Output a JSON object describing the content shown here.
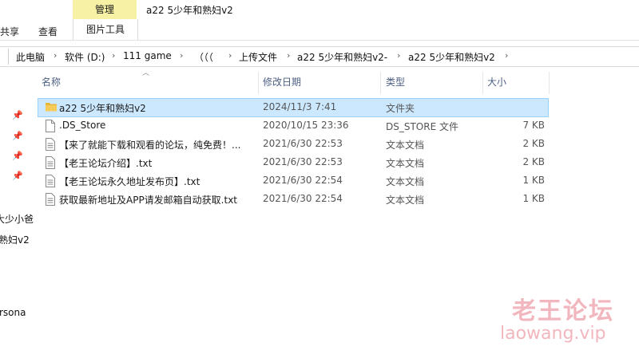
{
  "ribbon": {
    "tab_share": "共享",
    "tab_view": "查看",
    "context_group": "管理",
    "context_tab": "图片工具",
    "window_title": "a22 5少年和熟妇v2"
  },
  "breadcrumb": [
    "此电脑",
    "软件 (D:)",
    "111 game",
    "（（（",
    "上传文件",
    "a22 5少年和熟妇v2-",
    "a22 5少年和熟妇v2"
  ],
  "nav": {
    "partial_items": [
      "大少小爸",
      "熟妇v2",
      "rsona"
    ]
  },
  "columns": {
    "name": "名称",
    "date": "修改日期",
    "type": "类型",
    "size": "大小"
  },
  "files": [
    {
      "name": "a22 5少年和熟妇v2",
      "date": "2024/11/3 7:41",
      "type": "文件夹",
      "size": "",
      "icon": "folder-icon",
      "selected": true
    },
    {
      "name": ".DS_Store",
      "date": "2020/10/15 23:36",
      "type": "DS_STORE 文件",
      "size": "7 KB",
      "icon": "file-icon",
      "selected": false
    },
    {
      "name": "【来了就能下载和观看的论坛，纯免费！...",
      "date": "2021/6/30 22:53",
      "type": "文本文档",
      "size": "2 KB",
      "icon": "text-file-icon",
      "selected": false
    },
    {
      "name": "【老王论坛介绍】.txt",
      "date": "2021/6/30 22:53",
      "type": "文本文档",
      "size": "2 KB",
      "icon": "text-file-icon",
      "selected": false
    },
    {
      "name": "【老王论坛永久地址发布页】.txt",
      "date": "2021/6/30 22:54",
      "type": "文本文档",
      "size": "1 KB",
      "icon": "text-file-icon",
      "selected": false
    },
    {
      "name": "获取最新地址及APP请发邮箱自动获取.txt",
      "date": "2021/6/30 22:54",
      "type": "文本文档",
      "size": "1 KB",
      "icon": "text-file-icon",
      "selected": false
    }
  ],
  "watermark": {
    "title": "老王论坛",
    "url": "laowang.vip"
  },
  "colors": {
    "context_tab_bg": "#f7f1a6",
    "selection_bg": "#cce8ff",
    "selection_border": "#99d1ff",
    "header_text": "#4d6082",
    "watermark": "#f2b6be",
    "folder": "#e8b53a"
  }
}
